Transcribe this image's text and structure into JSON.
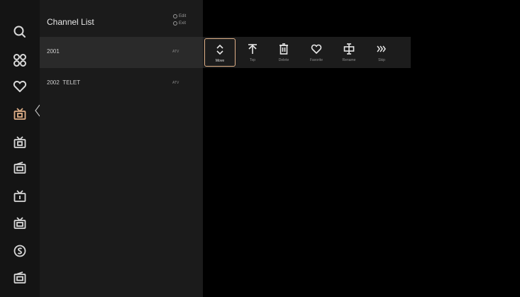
{
  "colors": {
    "accent": "#e0b088",
    "background": "#000000",
    "rail": "#141414",
    "panel": "#1b1b1b"
  },
  "sidebar": {
    "icons": [
      "search-icon",
      "apps-icon",
      "favorites-heart-icon",
      "tv-input-icon",
      "tv-source-icon",
      "radio-icon",
      "tv-source-2-icon",
      "radio-2-icon",
      "sound-icon",
      "radio-3-icon"
    ],
    "active_index": 3
  },
  "channel_list": {
    "title": "Channel List",
    "hint_edit": "Edit",
    "hint_exit": "Exit",
    "channels": [
      {
        "number": "2001",
        "name": "",
        "type": "ATV"
      },
      {
        "number": "2002",
        "name": "TELET",
        "type": "ATV"
      }
    ]
  },
  "toolbar": {
    "items": [
      {
        "label": "Move",
        "icon": "move-icon"
      },
      {
        "label": "Top",
        "icon": "top-icon"
      },
      {
        "label": "Delete",
        "icon": "delete-icon"
      },
      {
        "label": "Favorite",
        "icon": "favorite-icon"
      },
      {
        "label": "Rename",
        "icon": "rename-icon"
      },
      {
        "label": "Skip",
        "icon": "skip-icon"
      }
    ],
    "active_index": 0
  }
}
